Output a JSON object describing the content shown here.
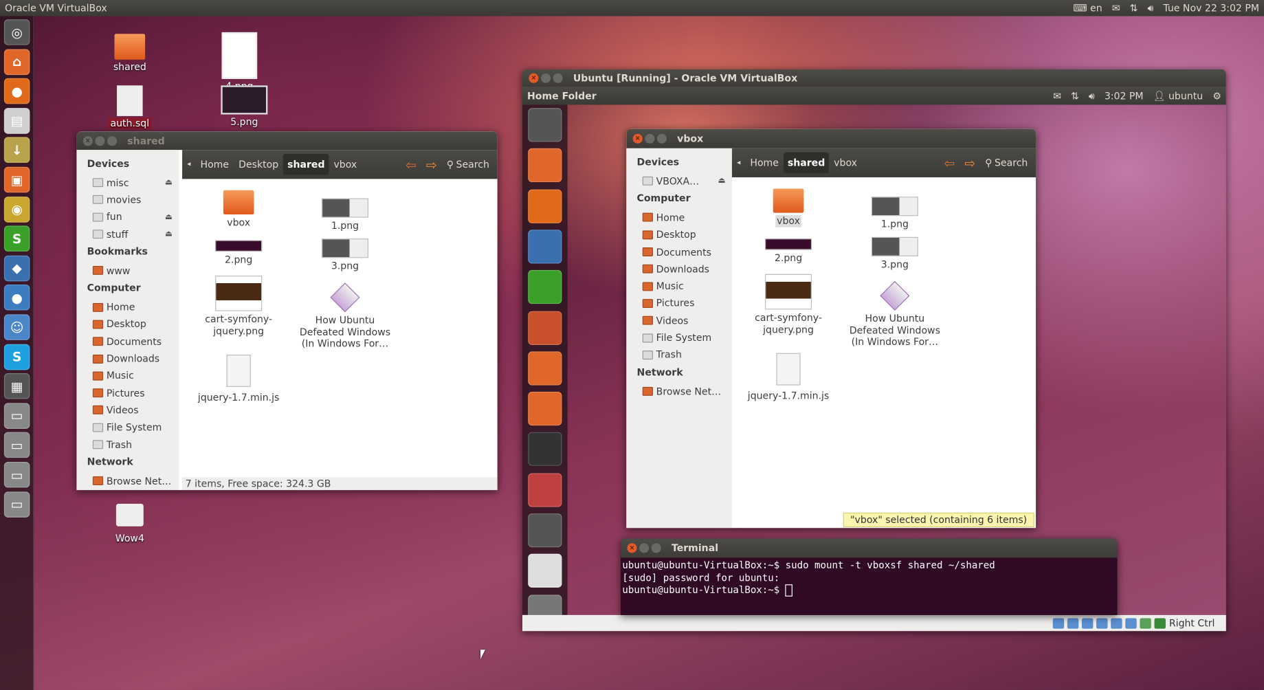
{
  "host_panel": {
    "title": "Oracle VM VirtualBox",
    "keyboard_layout": "en",
    "icons": [
      "keyboard-icon",
      "mail-icon",
      "network-icon",
      "volume-icon"
    ],
    "datetime": "Tue Nov 22  3:02 PM"
  },
  "host_launcher": [
    {
      "name": "dash-icon",
      "color": "#555555",
      "glyph": "◎"
    },
    {
      "name": "home-folder-icon",
      "color": "#e0662a",
      "glyph": "⌂"
    },
    {
      "name": "firefox-icon",
      "color": "#e06a1a",
      "glyph": "●"
    },
    {
      "name": "text-editor-icon",
      "color": "#cfcfcf",
      "glyph": "▤"
    },
    {
      "name": "archive-icon",
      "color": "#b9a34a",
      "glyph": "↓"
    },
    {
      "name": "software-center-icon",
      "color": "#e0662a",
      "glyph": "▣"
    },
    {
      "name": "chromium-icon",
      "color": "#c9a62e",
      "glyph": "◉"
    },
    {
      "name": "scrivener-icon",
      "color": "#3aa02a",
      "glyph": "S"
    },
    {
      "name": "virtualbox-icon",
      "color": "#3a6fb0",
      "glyph": "◆"
    },
    {
      "name": "pidgin-icon",
      "color": "#3c7cc0",
      "glyph": "●"
    },
    {
      "name": "empathy-icon",
      "color": "#4a86c8",
      "glyph": "☺"
    },
    {
      "name": "skype-icon",
      "color": "#1ea0e0",
      "glyph": "S"
    },
    {
      "name": "workspace-switcher-icon",
      "color": "#555555",
      "glyph": "▦"
    },
    {
      "name": "drive-icon-1",
      "color": "#888888",
      "glyph": "▭"
    },
    {
      "name": "drive-icon-2",
      "color": "#888888",
      "glyph": "▭"
    },
    {
      "name": "drive-icon-3",
      "color": "#888888",
      "glyph": "▭"
    },
    {
      "name": "drive-icon-4",
      "color": "#888888",
      "glyph": "▭"
    }
  ],
  "desktop_icons": [
    {
      "label": "shared",
      "type": "folder"
    },
    {
      "label": "4.png",
      "type": "image"
    },
    {
      "label": "auth.sql",
      "type": "sql"
    },
    {
      "label": "5.png",
      "type": "image"
    },
    {
      "label": "Wow4",
      "type": "app"
    }
  ],
  "shared_window": {
    "title": "shared",
    "sidebar": [
      {
        "heading": "Devices",
        "items": [
          {
            "label": "misc",
            "eject": true,
            "icon": "drive"
          },
          {
            "label": "movies",
            "eject": false,
            "icon": "drive"
          },
          {
            "label": "fun",
            "eject": true,
            "icon": "drive"
          },
          {
            "label": "stuff",
            "eject": true,
            "icon": "drive"
          }
        ]
      },
      {
        "heading": "Bookmarks",
        "items": [
          {
            "label": "www",
            "icon": "folder"
          }
        ]
      },
      {
        "heading": "Computer",
        "items": [
          {
            "label": "Home",
            "icon": "folder"
          },
          {
            "label": "Desktop",
            "icon": "folder"
          },
          {
            "label": "Documents",
            "icon": "folder"
          },
          {
            "label": "Downloads",
            "icon": "folder"
          },
          {
            "label": "Music",
            "icon": "folder"
          },
          {
            "label": "Pictures",
            "icon": "folder"
          },
          {
            "label": "Videos",
            "icon": "folder"
          },
          {
            "label": "File System",
            "icon": "drive"
          },
          {
            "label": "Trash",
            "icon": "drive"
          }
        ]
      },
      {
        "heading": "Network",
        "items": [
          {
            "label": "Browse Net…",
            "icon": "folder"
          }
        ]
      }
    ],
    "breadcrumbs": [
      "Home",
      "Desktop",
      "shared",
      "vbox"
    ],
    "active_crumb": "shared",
    "search_label": "Search",
    "files": [
      {
        "label": "vbox",
        "type": "folder"
      },
      {
        "label": "1.png",
        "type": "image"
      },
      {
        "label": "2.png",
        "type": "image"
      },
      {
        "label": "3.png",
        "type": "image"
      },
      {
        "label": "cart-symfony-jquery.png",
        "type": "image"
      },
      {
        "label": "How Ubuntu Defeated Windows (In Windows For…",
        "type": "ebook"
      },
      {
        "label": "jquery-1.7.min.js",
        "type": "script"
      }
    ],
    "status": "7 items, Free space: 324.3 GB"
  },
  "vm_window": {
    "title": "Ubuntu [Running] - Oracle VM VirtualBox",
    "guest_panel": {
      "app_title": "Home Folder",
      "time": "3:02 PM",
      "user": "ubuntu"
    },
    "guest_launcher": [
      "dash-icon",
      "home-folder-icon",
      "firefox-icon",
      "writer-icon",
      "calc-icon",
      "impress-icon",
      "software-center-icon",
      "ubuntu-one-icon",
      "terminal-icon",
      "system-settings-icon",
      "workspace-switcher-icon",
      "cd-icon",
      "trash-icon"
    ],
    "status_host_key": "Right Ctrl"
  },
  "vbox_window": {
    "title": "vbox",
    "sidebar": [
      {
        "heading": "Devices",
        "items": [
          {
            "label": "VBOXA…",
            "eject": true,
            "icon": "drive"
          }
        ]
      },
      {
        "heading": "Computer",
        "items": [
          {
            "label": "Home",
            "icon": "folder"
          },
          {
            "label": "Desktop",
            "icon": "folder"
          },
          {
            "label": "Documents",
            "icon": "folder"
          },
          {
            "label": "Downloads",
            "icon": "folder"
          },
          {
            "label": "Music",
            "icon": "folder"
          },
          {
            "label": "Pictures",
            "icon": "folder"
          },
          {
            "label": "Videos",
            "icon": "folder"
          },
          {
            "label": "File System",
            "icon": "drive"
          },
          {
            "label": "Trash",
            "icon": "drive"
          }
        ]
      },
      {
        "heading": "Network",
        "items": [
          {
            "label": "Browse Net…",
            "icon": "folder"
          }
        ]
      }
    ],
    "breadcrumbs": [
      "Home",
      "shared",
      "vbox"
    ],
    "active_crumb": "shared",
    "search_label": "Search",
    "files": [
      {
        "label": "vbox",
        "type": "folder",
        "selected": true
      },
      {
        "label": "1.png",
        "type": "image"
      },
      {
        "label": "2.png",
        "type": "image"
      },
      {
        "label": "3.png",
        "type": "image"
      },
      {
        "label": "cart-symfony-jquery.png",
        "type": "image"
      },
      {
        "label": "How Ubuntu Defeated Windows (In Windows For…",
        "type": "ebook"
      },
      {
        "label": "jquery-1.7.min.js",
        "type": "script"
      }
    ],
    "status": "\"vbox\" selected (containing 6 items)"
  },
  "terminal": {
    "title": "Terminal",
    "lines": [
      "ubuntu@ubuntu-VirtualBox:~$ sudo mount -t vboxsf shared ~/shared",
      "[sudo] password for ubuntu:",
      "ubuntu@ubuntu-VirtualBox:~$ "
    ]
  },
  "colors": {
    "panel": "#3c3b37",
    "accent": "#e25a2a",
    "terminal_bg": "#300a24"
  }
}
